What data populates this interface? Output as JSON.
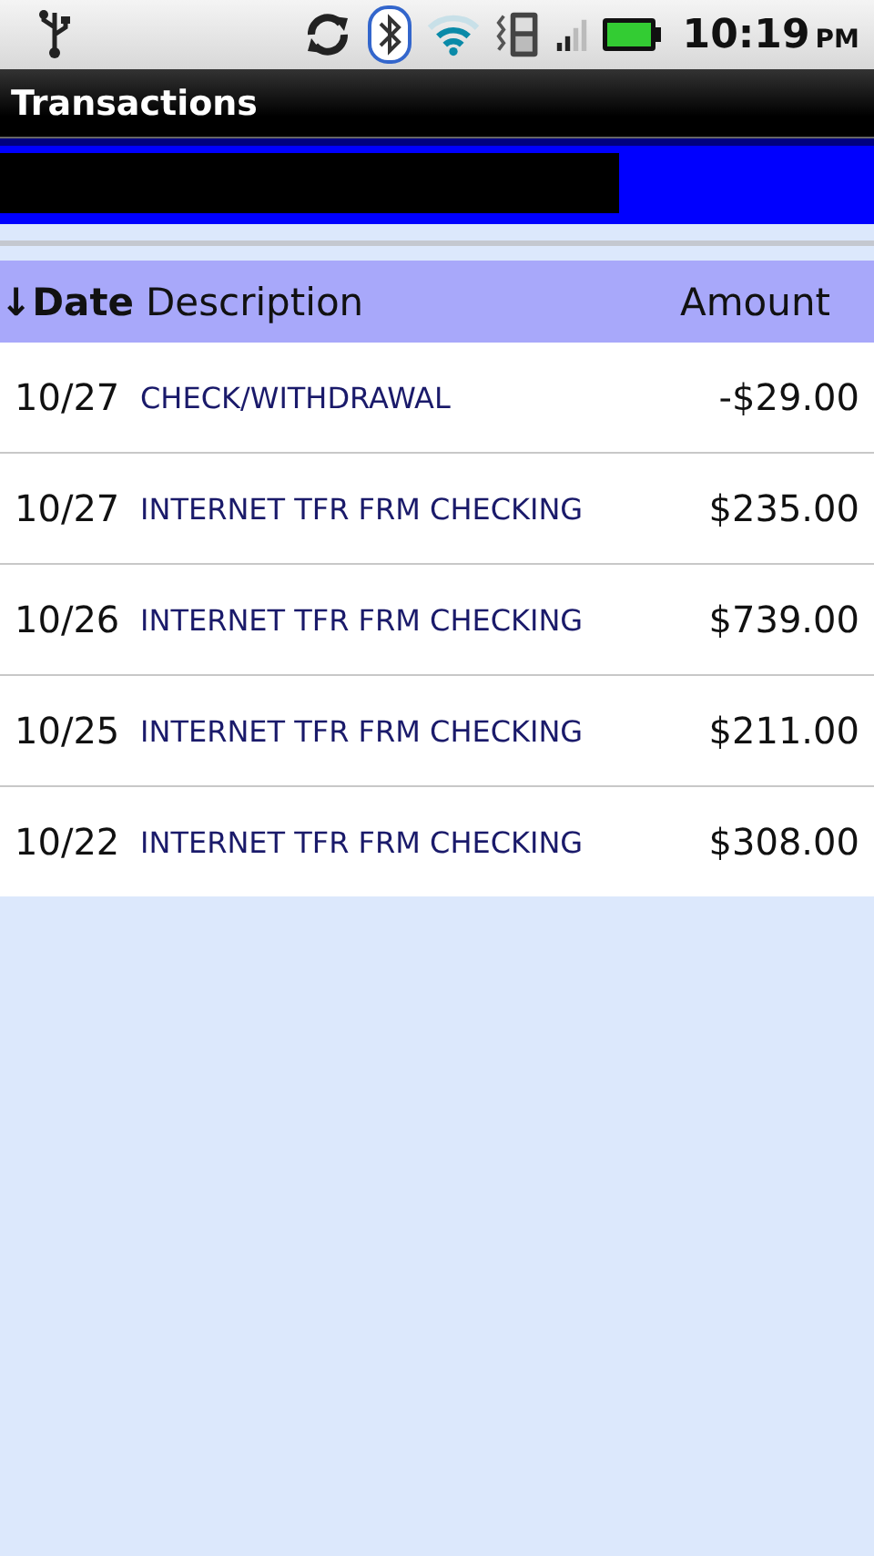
{
  "status_bar": {
    "time": "10:19",
    "meridiem": "PM"
  },
  "title_bar": {
    "title": "Transactions"
  },
  "table": {
    "columns": [
      {
        "label": "↓Date",
        "sorted": true
      },
      {
        "label": "Description",
        "sorted": false
      },
      {
        "label": "Amount",
        "sorted": false
      }
    ],
    "rows": [
      {
        "date": "10/27",
        "description": "CHECK/WITHDRAWAL",
        "amount": "-$29.00"
      },
      {
        "date": "10/27",
        "description": "INTERNET TFR FRM CHECKING",
        "amount": "$235.00"
      },
      {
        "date": "10/26",
        "description": "INTERNET TFR FRM CHECKING",
        "amount": "$739.00"
      },
      {
        "date": "10/25",
        "description": "INTERNET TFR FRM CHECKING",
        "amount": "$211.00"
      },
      {
        "date": "10/22",
        "description": "INTERNET TFR FRM CHECKING",
        "amount": "$308.00"
      }
    ]
  }
}
